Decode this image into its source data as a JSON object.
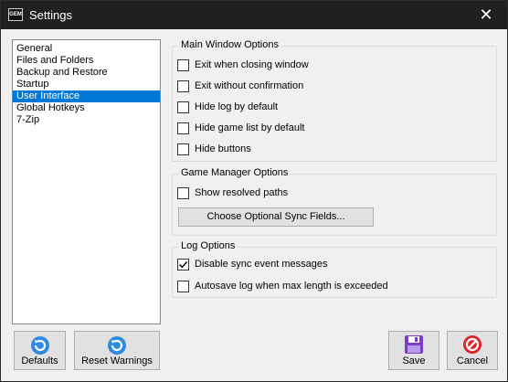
{
  "window": {
    "title": "Settings",
    "app_icon_text": "GEM"
  },
  "sidebar": {
    "items": [
      {
        "label": "General",
        "selected": false
      },
      {
        "label": "Files and Folders",
        "selected": false
      },
      {
        "label": "Backup and Restore",
        "selected": false
      },
      {
        "label": "Startup",
        "selected": false
      },
      {
        "label": "User Interface",
        "selected": true
      },
      {
        "label": "Global Hotkeys",
        "selected": false
      },
      {
        "label": "7-Zip",
        "selected": false
      }
    ]
  },
  "main_window_options": {
    "title": "Main Window Options",
    "items": [
      {
        "label": "Exit when closing window",
        "checked": false
      },
      {
        "label": "Exit without confirmation",
        "checked": false
      },
      {
        "label": "Hide log by default",
        "checked": false
      },
      {
        "label": "Hide game list by default",
        "checked": false
      },
      {
        "label": "Hide buttons",
        "checked": false
      }
    ]
  },
  "game_manager_options": {
    "title": "Game Manager Options",
    "show_resolved_paths": {
      "label": "Show resolved paths",
      "checked": false
    },
    "sync_fields_button": "Choose Optional Sync Fields..."
  },
  "log_options": {
    "title": "Log Options",
    "items": [
      {
        "label": "Disable sync event messages",
        "checked": true
      },
      {
        "label": "Autosave log when max length is exceeded",
        "checked": false
      }
    ]
  },
  "buttons": {
    "defaults": "Defaults",
    "reset_warnings": "Reset Warnings",
    "save": "Save",
    "cancel": "Cancel"
  },
  "colors": {
    "selection": "#0078d7",
    "titlebar": "#202020",
    "refresh_icon": "#2e8be0",
    "save_icon": "#7a3fc6",
    "cancel_icon": "#d9262c"
  }
}
